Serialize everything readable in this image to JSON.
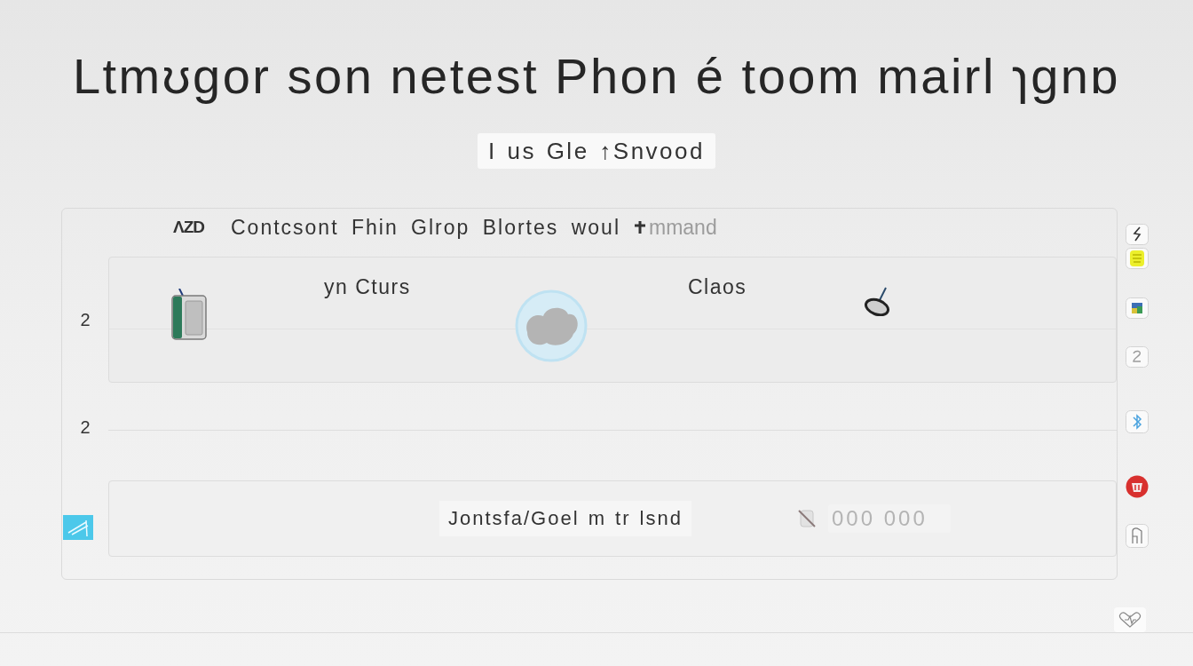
{
  "title": "Ltmʊɡor son netest Phon é toom mairl ɿɡnɒ",
  "subtitle": "I us Gle ↑Snvood",
  "panel": {
    "header": {
      "tag": "ΛZD",
      "heading": "Contcsont Fhin Glrop Blortes woul",
      "faded_text": "mmand"
    },
    "rows": [
      {
        "kind": "card",
        "number": "2",
        "label_1": "yn Cturs",
        "label_2": "Claos"
      },
      {
        "kind": "line",
        "number": "2"
      },
      {
        "kind": "field",
        "text": "Jontsfa/Goel m tr lsnd",
        "placeholder": "000 000"
      }
    ]
  }
}
